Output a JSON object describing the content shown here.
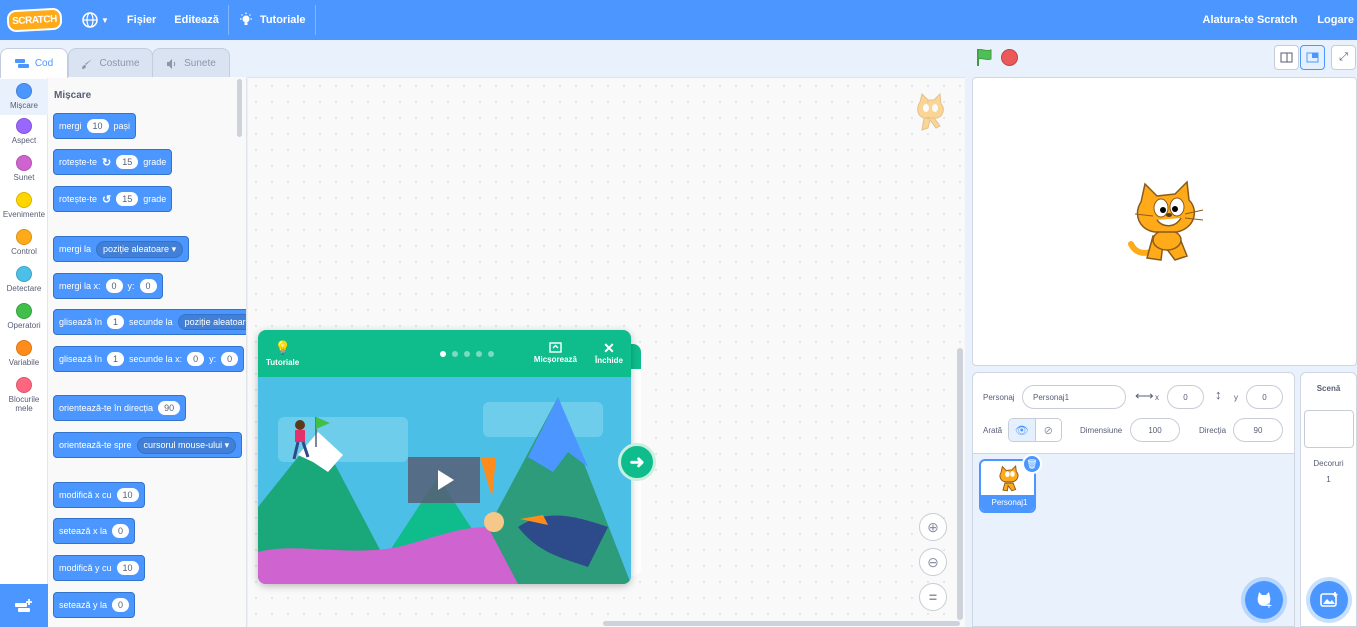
{
  "menubar": {
    "logo": "SCRATCH",
    "file": "Fișier",
    "edit": "Editează",
    "tutorials": "Tutoriale",
    "join": "Alatura-te Scratch",
    "login": "Logare"
  },
  "tabs": {
    "code": "Cod",
    "costumes": "Costume",
    "sounds": "Sunete"
  },
  "categories": [
    {
      "label": "Mișcare",
      "color": "#4c97ff"
    },
    {
      "label": "Aspect",
      "color": "#9966ff"
    },
    {
      "label": "Sunet",
      "color": "#cf63cf"
    },
    {
      "label": "Evenimente",
      "color": "#ffd500"
    },
    {
      "label": "Control",
      "color": "#ffab19"
    },
    {
      "label": "Detectare",
      "color": "#4cbfe6"
    },
    {
      "label": "Operatori",
      "color": "#40bf4a"
    },
    {
      "label": "Variabile",
      "color": "#ff8c1a"
    },
    {
      "label": "Blocurile mele",
      "color": "#ff6680"
    }
  ],
  "palette": {
    "heading": "Mișcare",
    "b1": {
      "t1": "mergi",
      "v1": "10",
      "t2": "pași"
    },
    "b2": {
      "t1": "rotește-te",
      "v1": "15",
      "t2": "grade"
    },
    "b3": {
      "t1": "rotește-te",
      "v1": "15",
      "t2": "grade"
    },
    "b4": {
      "t1": "mergi la",
      "d1": "poziție aleatoare"
    },
    "b5": {
      "t1": "mergi la x:",
      "v1": "0",
      "t2": "y:",
      "v2": "0"
    },
    "b6": {
      "t1": "glisează în",
      "v1": "1",
      "t2": "secunde la",
      "d1": "poziție aleatoare"
    },
    "b7": {
      "t1": "glisează în",
      "v1": "1",
      "t2": "secunde la x:",
      "v2": "0",
      "t3": "y:",
      "v3": "0"
    },
    "b8": {
      "t1": "orientează-te în direcția",
      "v1": "90"
    },
    "b9": {
      "t1": "orientează-te spre",
      "d1": "cursorul mouse-ului"
    },
    "b10": {
      "t1": "modifică x cu",
      "v1": "10"
    },
    "b11": {
      "t1": "setează x la",
      "v1": "0"
    },
    "b12": {
      "t1": "modifică y cu",
      "v1": "10"
    },
    "b13": {
      "t1": "setează y la",
      "v1": "0"
    }
  },
  "tutorial": {
    "label": "Tutoriale",
    "minimize": "Micșorează",
    "close": "Închide",
    "dots": 5,
    "active_dot": 1
  },
  "sprite": {
    "label": "Personaj",
    "name": "Personaj1",
    "x_label": "x",
    "x": "0",
    "y_label": "y",
    "y": "0",
    "show_label": "Arată",
    "size_label": "Dimensiune",
    "size": "100",
    "direction_label": "Direcția",
    "direction": "90",
    "thumb_label": "Personaj1"
  },
  "scene": {
    "title": "Scenă",
    "backdrops_label": "Decoruri",
    "backdrops_count": "1"
  },
  "colors": {
    "blue": "#4c97ff",
    "green": "#0fbd8c",
    "stop": "#ec5959",
    "flag": "#4cbf56"
  }
}
